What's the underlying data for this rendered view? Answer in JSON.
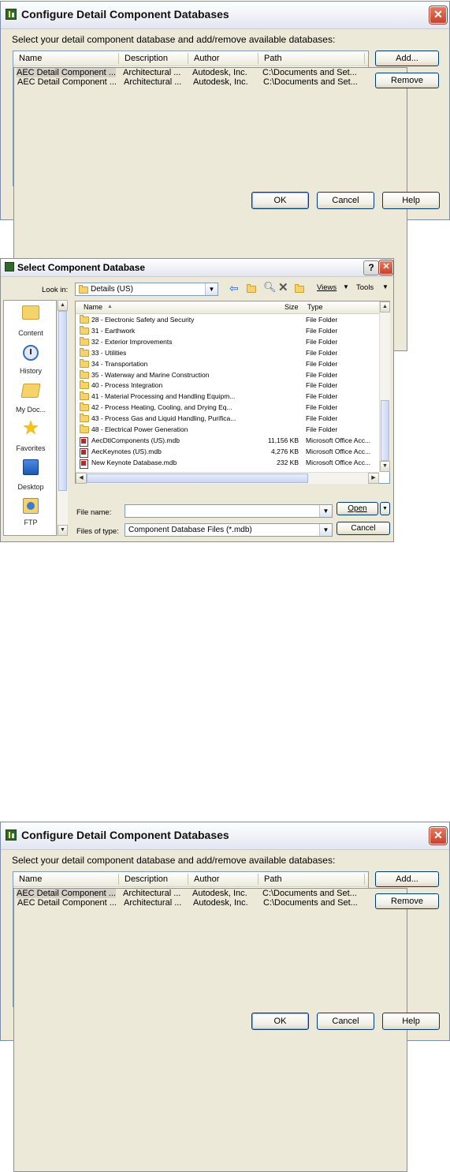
{
  "configure": {
    "title": "Configure Detail Component Databases",
    "instruction": "Select your detail component database and add/remove available databases:",
    "columns": [
      "Name",
      "Description",
      "Author",
      "Path"
    ],
    "rows": [
      {
        "name": "AEC Detail Component ...",
        "description": "Architectural ...",
        "author": "Autodesk, Inc.",
        "path": "C:\\Documents and Set..."
      },
      {
        "name": "AEC Detail Component ...",
        "description": "Architectural ...",
        "author": "Autodesk, Inc.",
        "path": "C:\\Documents and Set..."
      }
    ],
    "buttons": {
      "add": "Add...",
      "remove": "Remove",
      "ok": "OK",
      "cancel": "Cancel",
      "help": "Help"
    },
    "close_symbol": "✕"
  },
  "select_db": {
    "title": "Select Component Database",
    "help_symbol": "?",
    "close_symbol": "✕",
    "look_in_label": "Look in:",
    "look_in_value": "Details (US)",
    "views_label": "Views",
    "tools_label": "Tools",
    "places": [
      {
        "label": "Content",
        "icon": "content-folder-icon"
      },
      {
        "label": "History",
        "icon": "history-clock-icon"
      },
      {
        "label": "My Doc...",
        "icon": "my-documents-icon"
      },
      {
        "label": "Favorites",
        "icon": "favorites-star-icon"
      },
      {
        "label": "Desktop",
        "icon": "desktop-icon"
      },
      {
        "label": "FTP",
        "icon": "ftp-icon"
      }
    ],
    "columns": {
      "name": "Name",
      "size": "Size",
      "type": "Type"
    },
    "files": [
      {
        "name": "28 - Electronic Safety and Security",
        "size": "",
        "type": "File Folder",
        "kind": "folder"
      },
      {
        "name": "31 - Earthwork",
        "size": "",
        "type": "File Folder",
        "kind": "folder"
      },
      {
        "name": "32 - Exterior Improvements",
        "size": "",
        "type": "File Folder",
        "kind": "folder"
      },
      {
        "name": "33 - Utilities",
        "size": "",
        "type": "File Folder",
        "kind": "folder"
      },
      {
        "name": "34 - Transportation",
        "size": "",
        "type": "File Folder",
        "kind": "folder"
      },
      {
        "name": "35 - Waterway and Marine Construction",
        "size": "",
        "type": "File Folder",
        "kind": "folder"
      },
      {
        "name": "40 - Process Integration",
        "size": "",
        "type": "File Folder",
        "kind": "folder"
      },
      {
        "name": "41 - Material Processing and Handling Equipm...",
        "size": "",
        "type": "File Folder",
        "kind": "folder"
      },
      {
        "name": "42 - Process Heating, Cooling, and Drying Eq...",
        "size": "",
        "type": "File Folder",
        "kind": "folder"
      },
      {
        "name": "43 - Process Gas and Liquid Handling, Purifica...",
        "size": "",
        "type": "File Folder",
        "kind": "folder"
      },
      {
        "name": "48 - Electrical Power Generation",
        "size": "",
        "type": "File Folder",
        "kind": "folder"
      },
      {
        "name": "AecDtlComponents (US).mdb",
        "size": "11,156 KB",
        "type": "Microsoft Office Acc...",
        "kind": "mdb"
      },
      {
        "name": "AecKeynotes (US).mdb",
        "size": "4,276 KB",
        "type": "Microsoft Office Acc...",
        "kind": "mdb"
      },
      {
        "name": "New Keynote Database.mdb",
        "size": "232 KB",
        "type": "Microsoft Office Acc...",
        "kind": "mdb"
      }
    ],
    "file_name_label": "File name:",
    "file_name_value": "",
    "files_of_type_label": "Files of type:",
    "files_of_type_value": "Component Database Files (*.mdb)",
    "open_label": "Open",
    "cancel_label": "Cancel"
  }
}
